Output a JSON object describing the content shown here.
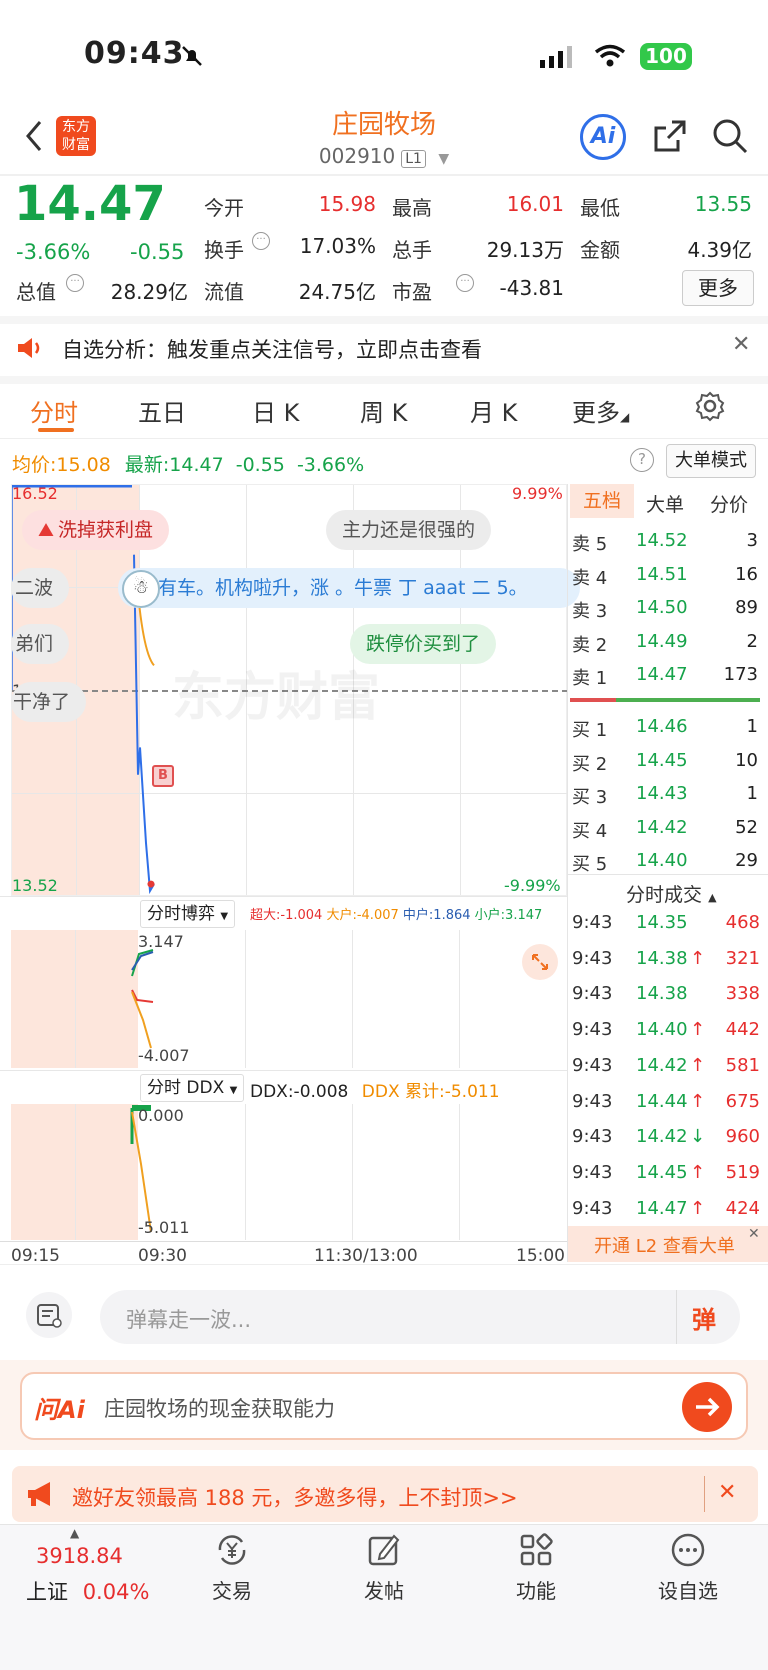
{
  "status": {
    "time": "09:43",
    "battery": "100"
  },
  "header": {
    "title": "庄园牧场",
    "code": "002910",
    "level_badge": "L1",
    "logo_text": "东方财富",
    "ai_label": "Ai"
  },
  "quote": {
    "price": "14.47",
    "change_pct": "-3.66%",
    "change": "-0.55",
    "fields": [
      {
        "label": "今开",
        "value": "15.98"
      },
      {
        "label": "最高",
        "value": "16.01"
      },
      {
        "label": "最低",
        "value": "13.55"
      },
      {
        "label": "换手",
        "value": "17.03%"
      },
      {
        "label": "总手",
        "value": "29.13万"
      },
      {
        "label": "金额",
        "value": "4.39亿"
      },
      {
        "label": "总值",
        "value": "28.29亿"
      },
      {
        "label": "流值",
        "value": "24.75亿"
      },
      {
        "label": "市盈",
        "value": "-43.81"
      }
    ],
    "more": "更多"
  },
  "notice": {
    "text": "自选分析：触发重点关注信号，立即点击查看"
  },
  "tabs": [
    "分时",
    "五日",
    "日 K",
    "周 K",
    "月 K",
    "更多"
  ],
  "chart_info": {
    "avg_label": "均价:",
    "avg": "15.08",
    "latest_label": "最新:",
    "latest": "14.47",
    "chg": "-0.55",
    "pct": "-3.66%",
    "big_order_mode": "大单模式"
  },
  "chart": {
    "high_label": "16.52",
    "low_label": "13.52",
    "mid_label": "15.02",
    "up_pct": "9.99%",
    "down_pct": "-9.99%",
    "watermark": "东方财富",
    "bubbles": [
      "洗掉获利盘",
      "主力还是很强的",
      "二波",
      "有车。机构啦升，涨  。牛票  丁 aaat 二 5。",
      "弟们",
      "跌停价买到了",
      "干净了"
    ],
    "marker": "B",
    "x_labels": [
      "09:15",
      "09:30",
      "11:30/13:00",
      "15:00"
    ]
  },
  "chart_data": [
    {
      "type": "line",
      "title": "分时",
      "x": [
        "09:30",
        "09:31",
        "09:32",
        "09:33",
        "09:34",
        "09:35",
        "09:36"
      ],
      "series": [
        {
          "values": [
            16.01,
            15.2,
            14.4,
            14.6,
            13.9,
            13.55,
            13.6
          ]
        }
      ],
      "ylim": [
        13.52,
        16.52
      ]
    },
    {
      "type": "line",
      "title": "分时博弈",
      "series": [
        {
          "name": "超大",
          "values": [
            -1.004
          ]
        },
        {
          "name": "大户",
          "values": [
            -4.007
          ]
        },
        {
          "name": "中户",
          "values": [
            1.864
          ]
        },
        {
          "name": "小户",
          "values": [
            3.147
          ]
        }
      ],
      "ylim": [
        -4.007,
        3.147
      ]
    },
    {
      "type": "line",
      "title": "分时DDX",
      "series": [
        {
          "name": "DDX",
          "values": [
            -0.008
          ]
        },
        {
          "name": "DDX累计",
          "values": [
            -5.011
          ]
        }
      ],
      "ylim": [
        -5.011,
        0.0
      ]
    }
  ],
  "sub1": {
    "title": "分时博弈",
    "legend": [
      {
        "k": "超大:",
        "v": "-1.004"
      },
      {
        "k": "大户:",
        "v": "-4.007"
      },
      {
        "k": "中户:",
        "v": "1.864"
      },
      {
        "k": "小户:",
        "v": "3.147"
      }
    ],
    "top": "3.147",
    "bottom": "-4.007"
  },
  "sub2": {
    "title": "分时 DDX",
    "ddx": "DDX:-0.008",
    "ddx_cum": "DDX 累计:-5.011",
    "top": "0.000",
    "bottom": "-5.011"
  },
  "orderbook": {
    "tabs": [
      "五档",
      "大单",
      "分价"
    ],
    "sells": [
      {
        "label": "卖 5",
        "price": "14.52",
        "vol": "3"
      },
      {
        "label": "卖 4",
        "price": "14.51",
        "vol": "16"
      },
      {
        "label": "卖 3",
        "price": "14.50",
        "vol": "89"
      },
      {
        "label": "卖 2",
        "price": "14.49",
        "vol": "2"
      },
      {
        "label": "卖 1",
        "price": "14.47",
        "vol": "173"
      }
    ],
    "buys": [
      {
        "label": "买 1",
        "price": "14.46",
        "vol": "1"
      },
      {
        "label": "买 2",
        "price": "14.45",
        "vol": "10"
      },
      {
        "label": "买 3",
        "price": "14.43",
        "vol": "1"
      },
      {
        "label": "买 4",
        "price": "14.42",
        "vol": "52"
      },
      {
        "label": "买 5",
        "price": "14.40",
        "vol": "29"
      }
    ],
    "trades_title": "分时成交",
    "trades": [
      {
        "time": "9:43",
        "price": "14.35",
        "arrow": "",
        "vol": "468"
      },
      {
        "time": "9:43",
        "price": "14.38",
        "arrow": "↑",
        "vol": "321"
      },
      {
        "time": "9:43",
        "price": "14.38",
        "arrow": "",
        "vol": "338"
      },
      {
        "time": "9:43",
        "price": "14.40",
        "arrow": "↑",
        "vol": "442"
      },
      {
        "time": "9:43",
        "price": "14.42",
        "arrow": "↑",
        "vol": "581"
      },
      {
        "time": "9:43",
        "price": "14.44",
        "arrow": "↑",
        "vol": "675"
      },
      {
        "time": "9:43",
        "price": "14.42",
        "arrow": "↓",
        "vol": "960"
      },
      {
        "time": "9:43",
        "price": "14.45",
        "arrow": "↑",
        "vol": "519"
      },
      {
        "time": "9:43",
        "price": "14.47",
        "arrow": "↑",
        "vol": "424"
      }
    ],
    "l2_cta": "开通 L2 查看大单"
  },
  "comment": {
    "placeholder": "弹幕走一波...",
    "danmu": "弹"
  },
  "ai_ask": {
    "brand": "问Ai",
    "prompt": "庄园牧场的现金获取能力"
  },
  "promo": {
    "text": "邀好友领最高 188 元，多邀多得，上不封顶>>"
  },
  "bottom_nav": {
    "index_value": "3918.84",
    "index_name": "上证",
    "index_pct": "0.04%",
    "items": [
      "交易",
      "发帖",
      "功能",
      "设自选"
    ]
  }
}
